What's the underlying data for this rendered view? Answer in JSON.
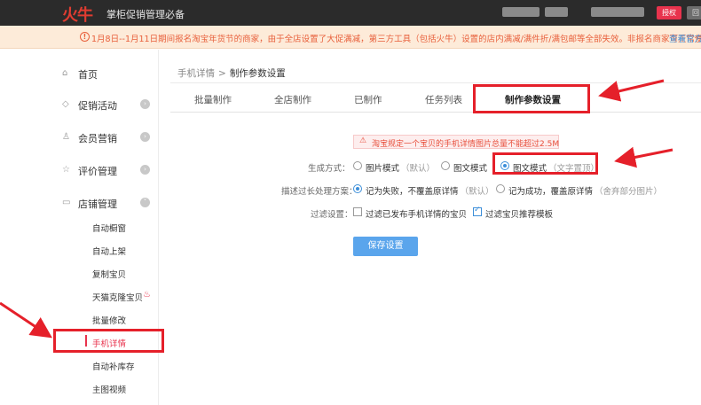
{
  "app": {
    "logo": "火牛",
    "title": "掌柜促销管理必备",
    "auth_label": "授权",
    "extra_label": "回"
  },
  "notice": {
    "text": "1月8日--1月11日期间报名淘宝年货节的商家，由于全店设置了大促满减，第三方工具（包括火牛）设置的店内满减/满件折/满包邮等全部失效。非报名商家可正常使用。",
    "link": "查看官方"
  },
  "sidebar": {
    "items": [
      {
        "label": "首页",
        "icon": "home-icon"
      },
      {
        "label": "促销活动",
        "icon": "tag-icon"
      },
      {
        "label": "会员营销",
        "icon": "user-icon"
      },
      {
        "label": "评价管理",
        "icon": "thumb-icon"
      },
      {
        "label": "店铺管理",
        "icon": "shop-icon"
      }
    ],
    "sub_items": [
      "自动橱窗",
      "自动上架",
      "复制宝贝",
      "天猫克隆宝贝",
      "批量修改",
      "手机详情",
      "自动补库存",
      "主图视频"
    ],
    "active_sub": "手机详情"
  },
  "breadcrumb": {
    "home": "手机详情",
    "separator": ">",
    "current": "制作参数设置"
  },
  "tabs": [
    "批量制作",
    "全店制作",
    "已制作",
    "任务列表",
    "制作参数设置"
  ],
  "active_tab": "制作参数设置",
  "warning": "淘宝规定一个宝贝的手机详情图片总量不能超过2.5M",
  "form": {
    "gen_mode": {
      "label": "生成方式：",
      "options": [
        {
          "label": "图片模式",
          "note": "（默认）",
          "checked": false
        },
        {
          "label": "图文模式",
          "note": "",
          "checked": false
        },
        {
          "label": "图文模式",
          "note": "（文字置顶）",
          "checked": true
        }
      ]
    },
    "overlong": {
      "label": "描述过长处理方案：",
      "options": [
        {
          "label": "记为失败，不覆盖原详情",
          "note": "（默认）",
          "checked": true
        },
        {
          "label": "记为成功，覆盖原详情",
          "note": "（舍弃部分图片）",
          "checked": false
        }
      ]
    },
    "filter": {
      "label": "过滤设置：",
      "options": [
        {
          "label": "过滤已发布手机详情的宝贝",
          "checked": false
        },
        {
          "label": "过滤宝贝推荐模板",
          "checked": true
        }
      ]
    },
    "save_label": "保存设置"
  },
  "colors": {
    "accent_red": "#e8334d",
    "notice_text": "#e8603c",
    "primary_blue": "#5aa5ec",
    "annotation_red": "#e5202a"
  }
}
